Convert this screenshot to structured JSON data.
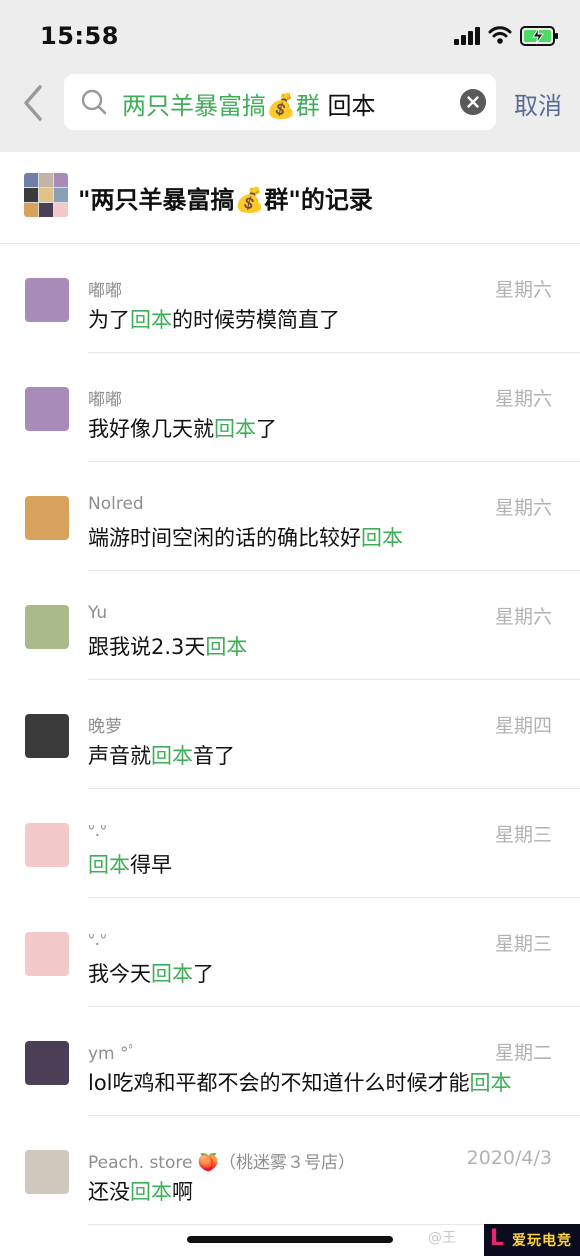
{
  "status_bar": {
    "time": "15:58"
  },
  "search": {
    "group_name": "两只羊暴富搞💰群",
    "keyword": "回本",
    "cancel_label": "取消"
  },
  "header": {
    "title": "\"两只羊暴富搞💰群\"的记录"
  },
  "colors": {
    "highlight": "#3fae59",
    "link": "#576b95",
    "topbar": "#ededed"
  },
  "results": [
    {
      "name": "嘟嘟",
      "date": "星期六",
      "pre": "为了",
      "hl": "回本",
      "post": "的时候劳模简直了",
      "avatar": "#a88bb8"
    },
    {
      "name": "嘟嘟",
      "date": "星期六",
      "pre": "我好像几天就",
      "hl": "回本",
      "post": "了",
      "avatar": "#a88bb8"
    },
    {
      "name": "Nolred",
      "date": "星期六",
      "pre": "端游时间空闲的话的确比较好",
      "hl": "回本",
      "post": "",
      "avatar": "#d9a25c"
    },
    {
      "name": "Yu",
      "date": "星期六",
      "pre": "跟我说2.3天",
      "hl": "回本",
      "post": "",
      "avatar": "#a9b98a"
    },
    {
      "name": "晚萝",
      "date": "星期四",
      "pre": "声音就",
      "hl": "回本",
      "post": "音了",
      "avatar": "#3b3b3b"
    },
    {
      "name": "ᐡ.ᐡ",
      "date": "星期三",
      "pre": "",
      "hl": "回本",
      "post": "得早",
      "avatar": "#f3c9c9"
    },
    {
      "name": "ᐡ.ᐡ",
      "date": "星期三",
      "pre": "我今天",
      "hl": "回本",
      "post": "了",
      "avatar": "#f3c9c9"
    },
    {
      "name": "ym °ﾟ",
      "date": "星期二",
      "pre": "lol吃鸡和平都不会的不知道什么时候才能",
      "hl": "回本",
      "post": "",
      "avatar": "#4b3f57"
    },
    {
      "name": "Peach. store 🍑（桃迷雾３号店）",
      "date": "2020/4/3",
      "pre": "还没",
      "hl": "回本",
      "post": "啊",
      "avatar": "#cfc8bc"
    }
  ],
  "watermark": {
    "text": "@王",
    "logo_text": "爱玩电竞"
  }
}
